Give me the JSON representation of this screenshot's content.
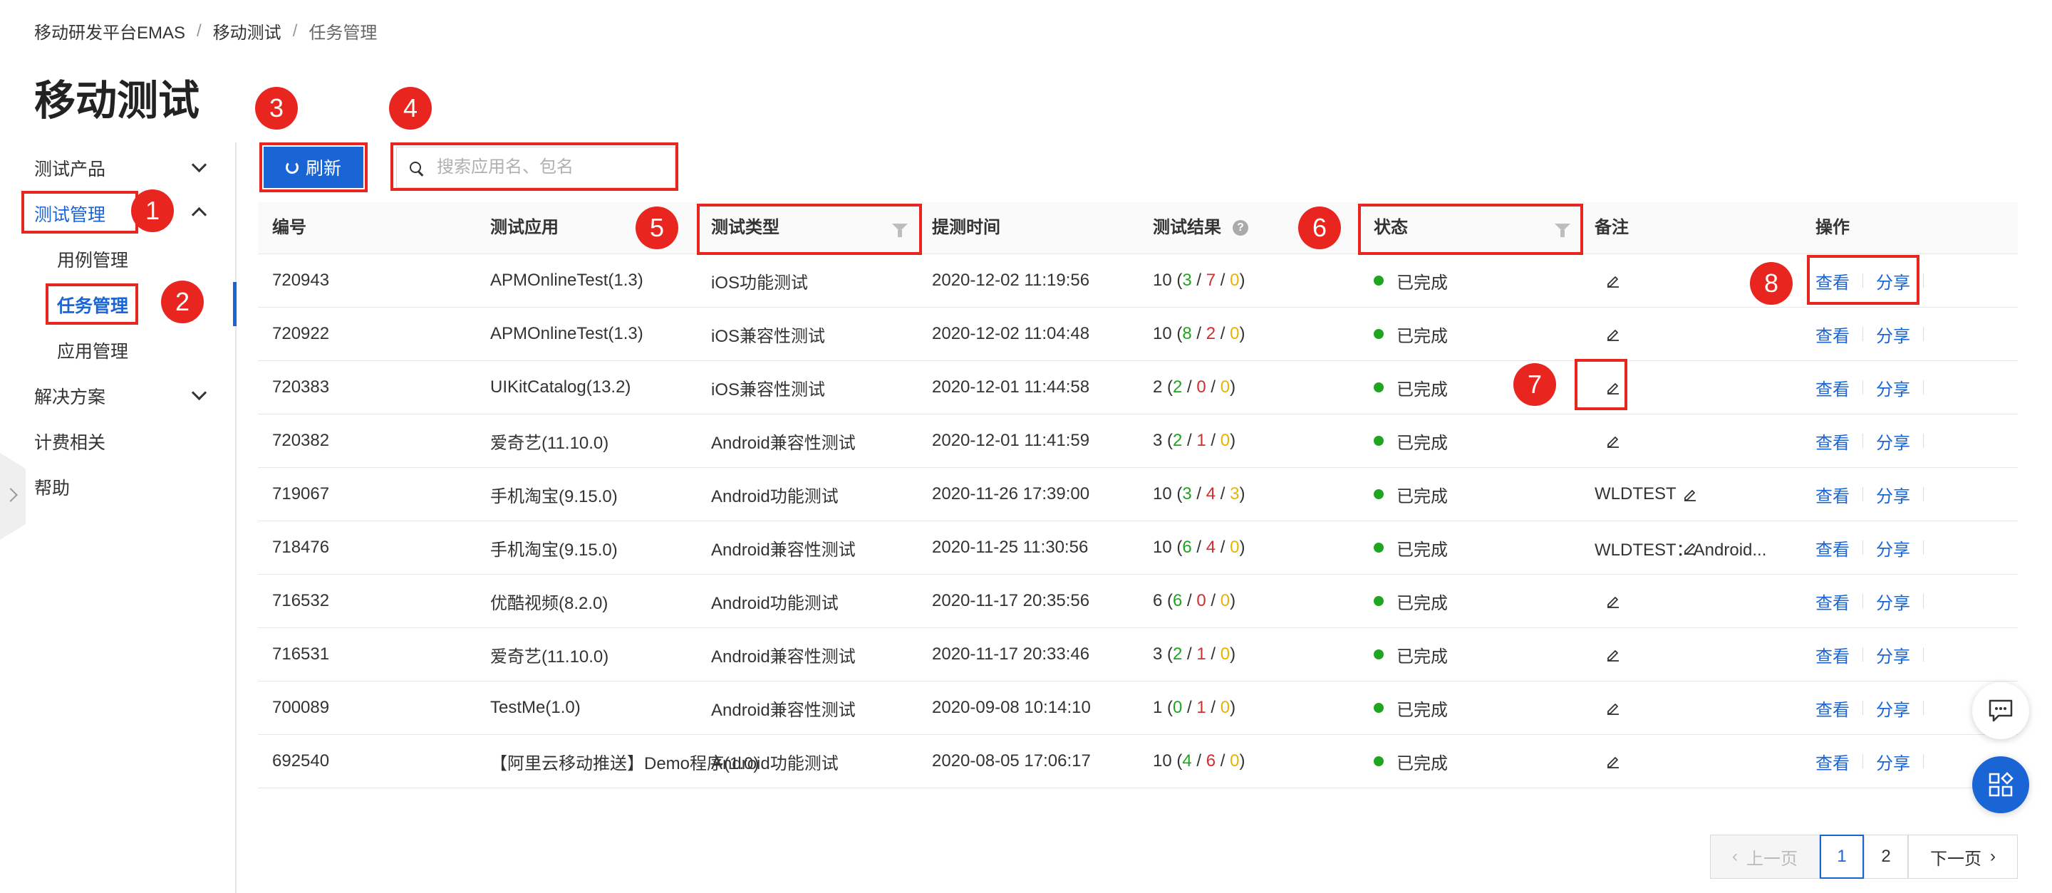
{
  "breadcrumb": [
    "移动研发平台EMAS",
    "移动测试",
    "任务管理"
  ],
  "page_title": "移动测试",
  "sidebar": {
    "items": [
      {
        "label": "测试产品"
      },
      {
        "label": "测试管理"
      },
      {
        "label": "用例管理"
      },
      {
        "label": "任务管理"
      },
      {
        "label": "应用管理"
      },
      {
        "label": "解决方案"
      },
      {
        "label": "计费相关"
      },
      {
        "label": "帮助"
      }
    ]
  },
  "annotations": [
    "1",
    "2",
    "3",
    "4",
    "5",
    "6",
    "7",
    "8"
  ],
  "toolbar": {
    "refresh_label": "刷新",
    "search_placeholder": "搜索应用名、包名"
  },
  "table": {
    "headers": [
      "编号",
      "测试应用",
      "测试类型",
      "提测时间",
      "测试结果",
      "状态",
      "备注",
      "操作"
    ],
    "rows": [
      {
        "id": "720943",
        "app": "APMOnlineTest(1.3)",
        "type": "iOS功能测试",
        "time": "2020-12-02 11:19:56",
        "total": "10",
        "pass": "3",
        "fail": "7",
        "warn": "0",
        "status": "已完成",
        "note": "",
        "view": "查看",
        "share": "分享"
      },
      {
        "id": "720922",
        "app": "APMOnlineTest(1.3)",
        "type": "iOS兼容性测试",
        "time": "2020-12-02 11:04:48",
        "total": "10",
        "pass": "8",
        "fail": "2",
        "warn": "0",
        "status": "已完成",
        "note": "",
        "view": "查看",
        "share": "分享"
      },
      {
        "id": "720383",
        "app": "UIKitCatalog(13.2)",
        "type": "iOS兼容性测试",
        "time": "2020-12-01 11:44:58",
        "total": "2",
        "pass": "2",
        "fail": "0",
        "warn": "0",
        "status": "已完成",
        "note": "",
        "view": "查看",
        "share": "分享"
      },
      {
        "id": "720382",
        "app": "爱奇艺(11.10.0)",
        "type": "Android兼容性测试",
        "time": "2020-12-01 11:41:59",
        "total": "3",
        "pass": "2",
        "fail": "1",
        "warn": "0",
        "status": "已完成",
        "note": "",
        "view": "查看",
        "share": "分享"
      },
      {
        "id": "719067",
        "app": "手机淘宝(9.15.0)",
        "type": "Android功能测试",
        "time": "2020-11-26 17:39:00",
        "total": "10",
        "pass": "3",
        "fail": "4",
        "warn": "3",
        "status": "已完成",
        "note": "WLDTEST",
        "view": "查看",
        "share": "分享"
      },
      {
        "id": "718476",
        "app": "手机淘宝(9.15.0)",
        "type": "Android兼容性测试",
        "time": "2020-11-25 11:30:56",
        "total": "10",
        "pass": "6",
        "fail": "4",
        "warn": "0",
        "status": "已完成",
        "note": "WLDTEST：Android...",
        "view": "查看",
        "share": "分享"
      },
      {
        "id": "716532",
        "app": "优酷视频(8.2.0)",
        "type": "Android功能测试",
        "time": "2020-11-17 20:35:56",
        "total": "6",
        "pass": "6",
        "fail": "0",
        "warn": "0",
        "status": "已完成",
        "note": "",
        "view": "查看",
        "share": "分享"
      },
      {
        "id": "716531",
        "app": "爱奇艺(11.10.0)",
        "type": "Android兼容性测试",
        "time": "2020-11-17 20:33:46",
        "total": "3",
        "pass": "2",
        "fail": "1",
        "warn": "0",
        "status": "已完成",
        "note": "",
        "view": "查看",
        "share": "分享"
      },
      {
        "id": "700089",
        "app": "TestMe(1.0)",
        "type": "Android兼容性测试",
        "time": "2020-09-08 10:14:10",
        "total": "1",
        "pass": "0",
        "fail": "1",
        "warn": "0",
        "status": "已完成",
        "note": "",
        "view": "查看",
        "share": "分享"
      },
      {
        "id": "692540",
        "app": "【阿里云移动推送】Demo程序(1.0)",
        "type": "Android功能测试",
        "time": "2020-08-05 17:06:17",
        "total": "10",
        "pass": "4",
        "fail": "6",
        "warn": "0",
        "status": "已完成",
        "note": "",
        "view": "查看",
        "share": "分享"
      }
    ]
  },
  "pagination": {
    "prev": "上一页",
    "pages": [
      "1",
      "2"
    ],
    "current": "1",
    "next": "下一页"
  },
  "colors": {
    "primary": "#1a65d6",
    "annotation": "#e8261f",
    "success": "#1fa51f",
    "fail": "#d12e2e",
    "warn": "#e8b400"
  }
}
